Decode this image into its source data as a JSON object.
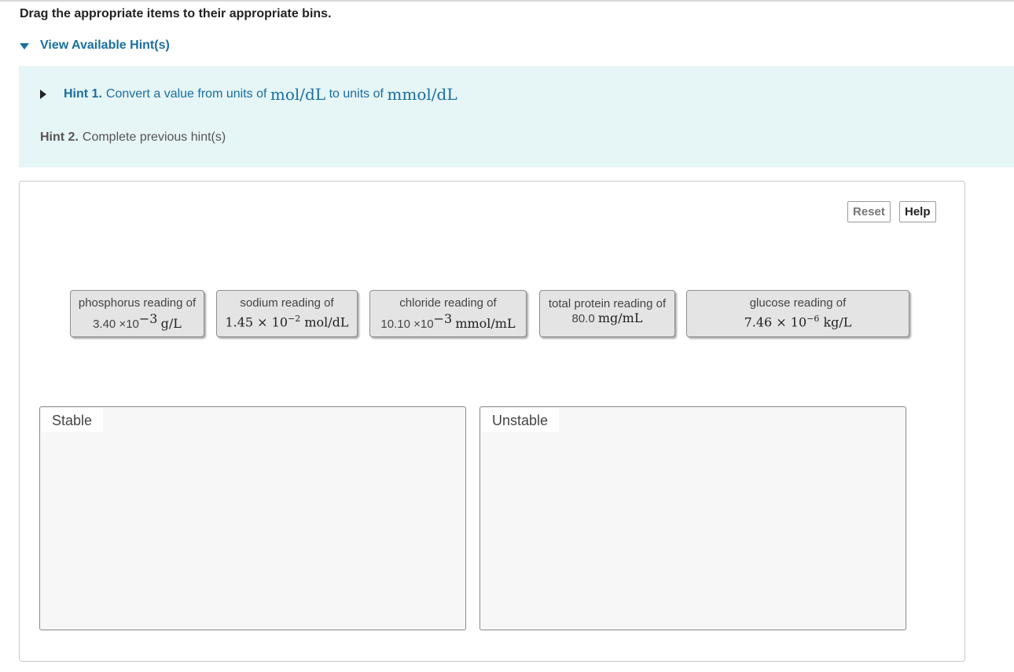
{
  "instruction": "Drag the appropriate items to their appropriate bins.",
  "hints_toggle": {
    "label": "View Available Hint(s)"
  },
  "hints": {
    "hint1": {
      "label": "Hint 1.",
      "text_before": "Convert a value from units of",
      "unit_from": "mol/dL",
      "text_mid": "to units of",
      "unit_to": "mmol/dL"
    },
    "hint2": {
      "label": "Hint 2.",
      "text": "Complete previous hint(s)"
    }
  },
  "buttons": {
    "reset": "Reset",
    "help": "Help"
  },
  "items": [
    {
      "line1": "phosphorus reading of",
      "value": "3.40 ×10",
      "exp": "−3",
      "unit": "g/L"
    },
    {
      "line1": "sodium reading of",
      "value": "1.45 × 10",
      "exp": "−2",
      "unit": "mol/dL"
    },
    {
      "line1": "chloride reading of",
      "value": "10.10 ×10",
      "exp": "−3",
      "unit": "mmol/mL"
    },
    {
      "line1": "total protein reading of",
      "value": "80.0",
      "exp": "",
      "unit": "mg/mL"
    },
    {
      "line1": "glucose reading of",
      "value": "7.46 × 10",
      "exp": "−6",
      "unit": "kg/L"
    }
  ],
  "bins": [
    {
      "label": "Stable"
    },
    {
      "label": "Unstable"
    }
  ]
}
